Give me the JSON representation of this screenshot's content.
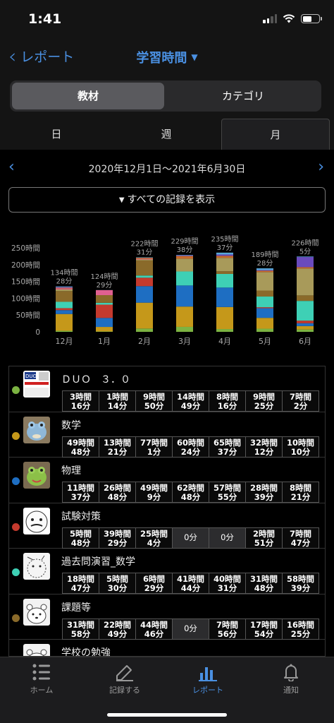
{
  "status": {
    "time": "1:41"
  },
  "nav": {
    "back_label": "レポート",
    "title": "学習時間"
  },
  "segment": {
    "options": [
      "教材",
      "カテゴリ"
    ],
    "selected": "教材"
  },
  "period_tabs": {
    "items": [
      "日",
      "週",
      "月"
    ],
    "selected": "月"
  },
  "range": {
    "label": "2020年12月1日〜2021年6月30日"
  },
  "show_all": {
    "label": "すべての記録を表示"
  },
  "colors": {
    "accent": "#4a90e2"
  },
  "chart_data": {
    "type": "bar",
    "stacked": true,
    "categories": [
      "12月",
      "1月",
      "2月",
      "3月",
      "4月",
      "5月",
      "6月"
    ],
    "y_ticks": [
      "0",
      "50時間",
      "100時間",
      "150時間",
      "200時間",
      "250時間"
    ],
    "ylim": [
      0,
      250
    ],
    "totals": [
      [
        "134時間",
        "28分"
      ],
      [
        "124時間",
        "29分"
      ],
      [
        "222時間",
        "31分"
      ],
      [
        "229時間",
        "38分"
      ],
      [
        "235時間",
        "37分"
      ],
      [
        "189時間",
        "28分"
      ],
      [
        "226時間",
        "5分"
      ]
    ],
    "series": [
      {
        "color": "#7cb342",
        "values": [
          3.3,
          1.2,
          9.8,
          14.8,
          8.3,
          9.4,
          7.0
        ]
      },
      {
        "color": "#c5981a",
        "values": [
          49.8,
          13.4,
          77.0,
          60.4,
          65.6,
          32.2,
          10.2
        ]
      },
      {
        "color": "#1e6ec2",
        "values": [
          11.6,
          26.8,
          49.2,
          62.8,
          57.9,
          28.7,
          8.4
        ]
      },
      {
        "color": "#c43a2e",
        "values": [
          5.8,
          39.5,
          25.1,
          0,
          0,
          2.9,
          7.8
        ]
      },
      {
        "color": "#3ed0b5",
        "values": [
          18.8,
          5.5,
          6.5,
          41.7,
          40.5,
          31.8,
          58.7
        ]
      },
      {
        "color": "#8a6a2a",
        "values": [
          31.97,
          22.8,
          44.8,
          0,
          7.9,
          17.9,
          16.4
        ]
      },
      {
        "color": "#a89a5a",
        "values": [
          5,
          0,
          3,
          38,
          40,
          55,
          80
        ]
      },
      {
        "color": "#e06090",
        "values": [
          3,
          15,
          2,
          0,
          0,
          0,
          0
        ]
      },
      {
        "color": "#c86a2a",
        "values": [
          2,
          0,
          3,
          8,
          6,
          4,
          4
        ]
      },
      {
        "color": "#6a4abd",
        "values": [
          2,
          0,
          0,
          2,
          4,
          2,
          30
        ]
      },
      {
        "color": "#58a8d8",
        "values": [
          1.8,
          0.2,
          1.3,
          1.3,
          5.5,
          5.1,
          1.6
        ]
      }
    ]
  },
  "materials": [
    {
      "name": "ＤＵＯ　３．０",
      "color": "#7cb342",
      "thumb": "book",
      "cells": [
        "3時間\n16分",
        "1時間\n14分",
        "9時間\n50分",
        "14時間\n49分",
        "8時間\n16分",
        "9時間\n25分",
        "7時間\n2分"
      ]
    },
    {
      "name": "数学",
      "color": "#c5981a",
      "thumb": "frog-blue",
      "cells": [
        "49時間\n48分",
        "13時間\n21分",
        "77時間\n1分",
        "60時間\n24分",
        "65時間\n37分",
        "32時間\n12分",
        "10時間\n10分"
      ]
    },
    {
      "name": "物理",
      "color": "#1e6ec2",
      "thumb": "frog-green",
      "cells": [
        "11時間\n37分",
        "26時間\n48分",
        "49時間\n9分",
        "62時間\n48分",
        "57時間\n55分",
        "28時間\n39分",
        "8時間\n21分"
      ]
    },
    {
      "name": "試験対策",
      "color": "#c43a2e",
      "thumb": "face",
      "cells": [
        "5時間\n48分",
        "39時間\n29分",
        "25時間\n4分",
        "0分",
        "0分",
        "2時間\n51分",
        "7時間\n47分"
      ]
    },
    {
      "name": "過去問演習_数学",
      "color": "#3ed0b5",
      "thumb": "sketch",
      "cells": [
        "18時間\n47分",
        "5時間\n30分",
        "6時間\n29分",
        "41時間\n44分",
        "40時間\n31分",
        "31時間\n48分",
        "58時間\n39分"
      ]
    },
    {
      "name": "課題等",
      "color": "#8a6a2a",
      "thumb": "bear",
      "cells": [
        "31時間\n58分",
        "22時間\n49分",
        "44時間\n46分",
        "0分",
        "7時間\n56分",
        "17時間\n54分",
        "16時間\n25分"
      ]
    },
    {
      "name": "学校の勉強",
      "color": "#a89a5a",
      "thumb": "bear",
      "cells": []
    }
  ],
  "tabbar": {
    "items": [
      {
        "label": "ホーム",
        "icon": "list-icon"
      },
      {
        "label": "記録する",
        "icon": "pencil-icon"
      },
      {
        "label": "レポート",
        "icon": "bar-chart-icon"
      },
      {
        "label": "通知",
        "icon": "bell-icon"
      }
    ],
    "selected": "レポート"
  }
}
